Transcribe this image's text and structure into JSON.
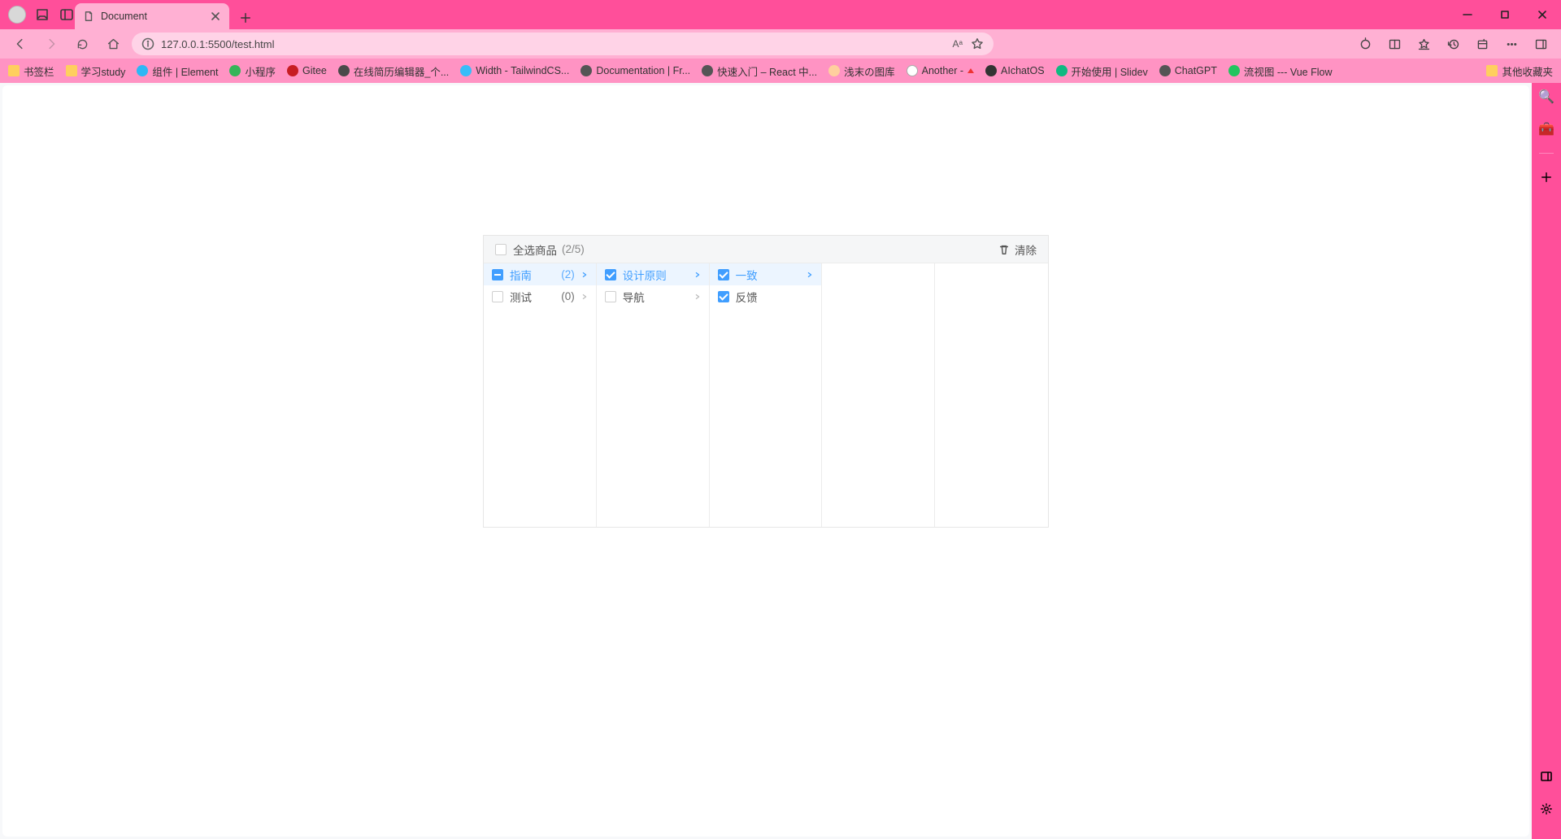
{
  "browser": {
    "tab_title": "Document",
    "url": "127.0.0.1:5500/test.html",
    "url_reader_badge": "Aᵃ",
    "bookmarks": [
      {
        "label": "书签栏",
        "kind": "folder"
      },
      {
        "label": "学习study",
        "kind": "folder"
      },
      {
        "label": "组件 | Element",
        "kind": "site",
        "cls": "c-el"
      },
      {
        "label": "小程序",
        "kind": "site",
        "cls": "c-wx"
      },
      {
        "label": "Gitee",
        "kind": "site",
        "cls": "c-gi"
      },
      {
        "label": "在线简历编辑器_个...",
        "kind": "site",
        "cls": "c-doc"
      },
      {
        "label": "Width - TailwindCS...",
        "kind": "site",
        "cls": "c-tw"
      },
      {
        "label": "Documentation | Fr...",
        "kind": "site",
        "cls": "c-rd"
      },
      {
        "label": "快速入门 – React 中...",
        "kind": "site",
        "cls": "c-re"
      },
      {
        "label": "浅末の图库",
        "kind": "site",
        "cls": "c-pic"
      },
      {
        "label": "Another -",
        "kind": "site",
        "cls": "c-an",
        "tri": true
      },
      {
        "label": "AIchatOS",
        "kind": "site",
        "cls": "c-ai"
      },
      {
        "label": "开始使用 | Slidev",
        "kind": "site",
        "cls": "c-sl"
      },
      {
        "label": "ChatGPT",
        "kind": "site",
        "cls": "c-gpt"
      },
      {
        "label": "流视图 --- Vue Flow",
        "kind": "site",
        "cls": "c-vf"
      }
    ],
    "bookmarks_overflow": "其他收藏夹"
  },
  "widget": {
    "select_all_label": "全选商品",
    "count": "(2/5)",
    "clear_label": "清除",
    "columns": [
      [
        {
          "label": "指南",
          "count": "(2)",
          "check": "ind",
          "active": true,
          "expand": true
        },
        {
          "label": "测试",
          "count": "(0)",
          "check": "off",
          "active": false,
          "expand": true
        }
      ],
      [
        {
          "label": "设计原则",
          "check": "chk",
          "active": true,
          "expand": true
        },
        {
          "label": "导航",
          "check": "off",
          "active": false,
          "expand": true
        }
      ],
      [
        {
          "label": "一致",
          "check": "chk",
          "active": true,
          "expand": true
        },
        {
          "label": "反馈",
          "check": "chk",
          "active": false,
          "expand": false
        }
      ]
    ]
  }
}
